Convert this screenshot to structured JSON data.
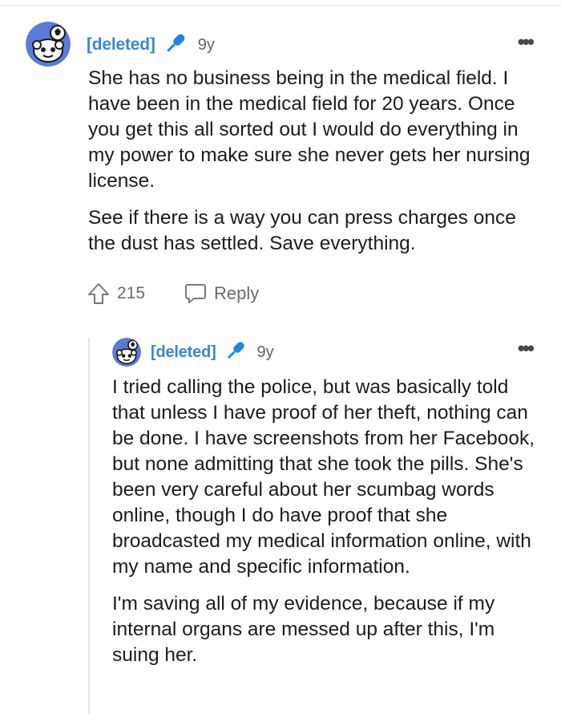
{
  "comments": [
    {
      "username": "[deleted]",
      "age": "9y",
      "more_icon": "more-horizontal-icon",
      "paragraphs": [
        "She has no business being in the medical field. I have been in the medical field for 20 years. Once you get this all sorted out I would do everything in my power to make sure she never gets her nursing license.",
        "See if there is a way you can press charges once the dust has settled. Save everything."
      ],
      "votes": "215",
      "reply_label": "Reply"
    },
    {
      "username": "[deleted]",
      "age": "9y",
      "more_icon": "more-horizontal-icon",
      "paragraphs": [
        "I tried calling the police, but was basically told that unless I have proof of her theft, nothing can be done. I have screenshots from her Facebook, but none admitting that she took the pills. She's been very careful about her scumbag words online, though I do have proof that she broadcasted my medical information online, with my name and specific information.",
        "I'm saving all of my evidence, because if my internal organs are messed up after this, I'm suing her."
      ]
    }
  ],
  "colors": {
    "username": "#3c85d1",
    "mic": "#1e88e5",
    "meta_text": "#5f6368",
    "body_text": "#1c1c1c"
  }
}
